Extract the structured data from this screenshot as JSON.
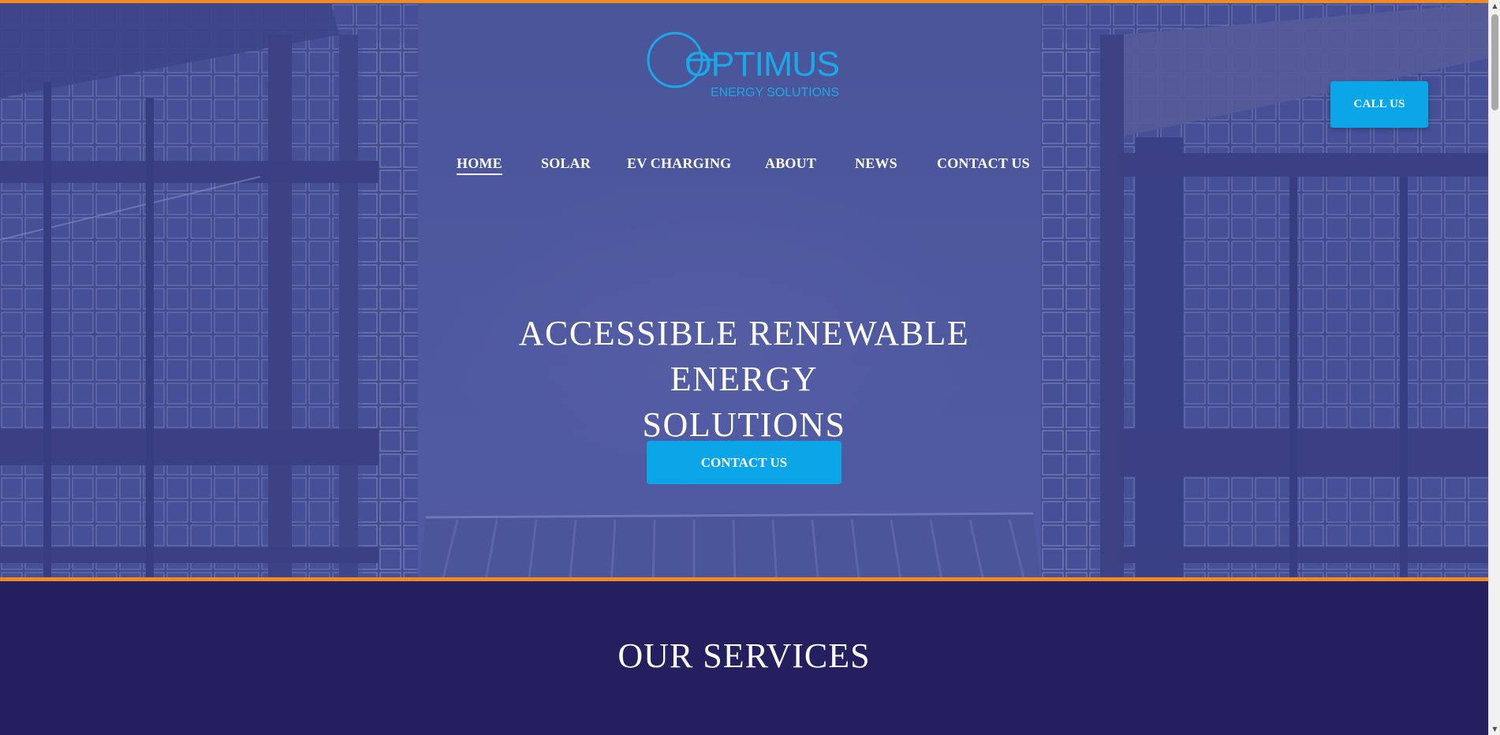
{
  "header": {
    "logo": {
      "name": "OPTIMUS",
      "tagline": "ENERGY SOLUTIONS",
      "color": "#1aa8e6"
    },
    "call_button": "CALL US"
  },
  "nav": {
    "items": [
      {
        "label": "HOME",
        "active": true
      },
      {
        "label": "SOLAR"
      },
      {
        "label": "EV CHARGING"
      },
      {
        "label": "ABOUT"
      },
      {
        "label": "NEWS"
      },
      {
        "label": "CONTACT US"
      }
    ]
  },
  "hero": {
    "title_line1": "ACCESSIBLE RENEWABLE ENERGY",
    "title_line2": "SOLUTIONS",
    "cta": "CONTACT US"
  },
  "services": {
    "heading": "OUR SERVICES"
  },
  "colors": {
    "accent_orange": "#f08a24",
    "button_blue": "#0aa6e8",
    "hero_overlay": "#4a5596",
    "section_bg": "#241f5e"
  }
}
